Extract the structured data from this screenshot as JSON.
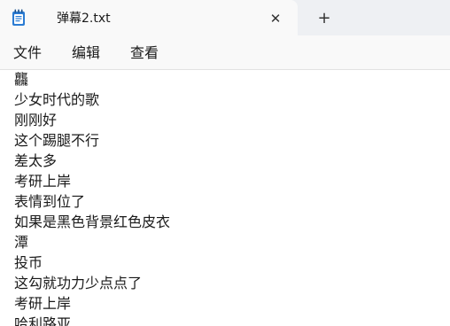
{
  "tab": {
    "title": "弹幕2.txt",
    "close_glyph": "✕",
    "new_tab_glyph": "+"
  },
  "menu": {
    "file": "文件",
    "edit": "编辑",
    "view": "查看"
  },
  "editor": {
    "lines": [
      "龘",
      "少女时代的歌",
      "刚刚好",
      "这个踢腿不行",
      "差太多",
      "考研上岸",
      "表情到位了",
      "如果是黑色背景红色皮衣",
      "潭",
      "投币",
      "这勾就功力少点点了",
      "考研上岸",
      "哈利路亚"
    ]
  },
  "colors": {
    "accent": "#2b7cd3",
    "titlebar": "#eef0f3",
    "tab_bg": "#f9f9f9"
  },
  "icons": {
    "app": "notepad-icon",
    "close": "close-icon",
    "new_tab": "plus-icon"
  }
}
